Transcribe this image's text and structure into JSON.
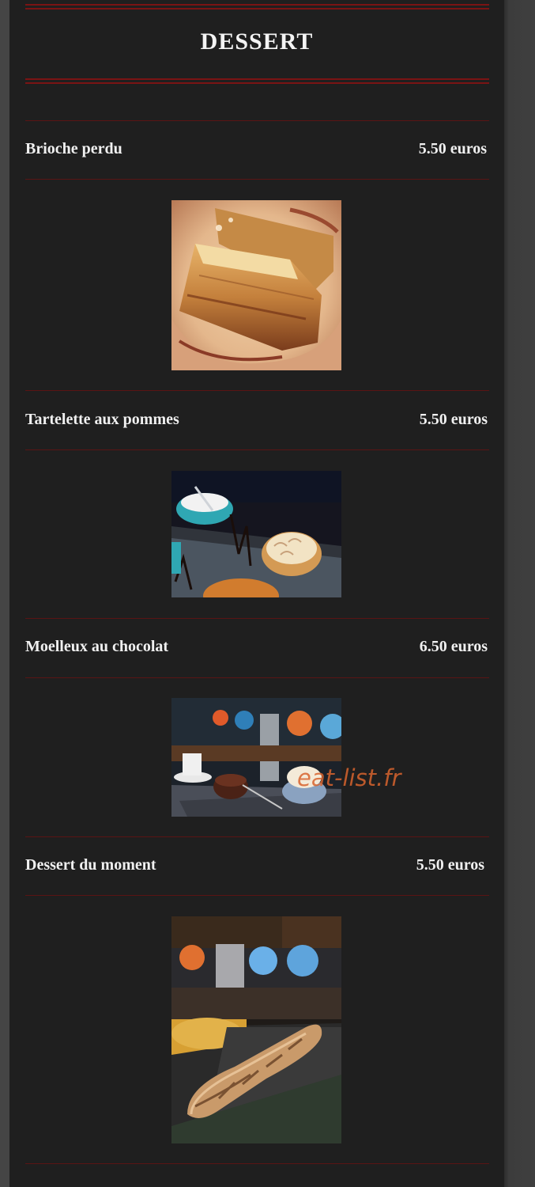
{
  "section": {
    "title": "DESSERT"
  },
  "items": [
    {
      "name": "Brioche perdu",
      "price": "5.50 euros",
      "photo_icon": "brioche-photo"
    },
    {
      "name": "Tartelette aux pommes",
      "price": "5.50 euros",
      "photo_icon": "tartelette-photo"
    },
    {
      "name": "Moelleux au chocolat",
      "price": "6.50 euros",
      "photo_icon": "moelleux-photo"
    },
    {
      "name": "Dessert du moment",
      "price": "5.50 euros",
      "photo_icon": "dessert-moment-photo"
    }
  ],
  "watermark": "eat-list.fr",
  "colors": {
    "panel_background": "#1f1f1f",
    "rule_red": "#7a1414",
    "text": "#f2f2f2",
    "watermark": "#d8642e"
  }
}
